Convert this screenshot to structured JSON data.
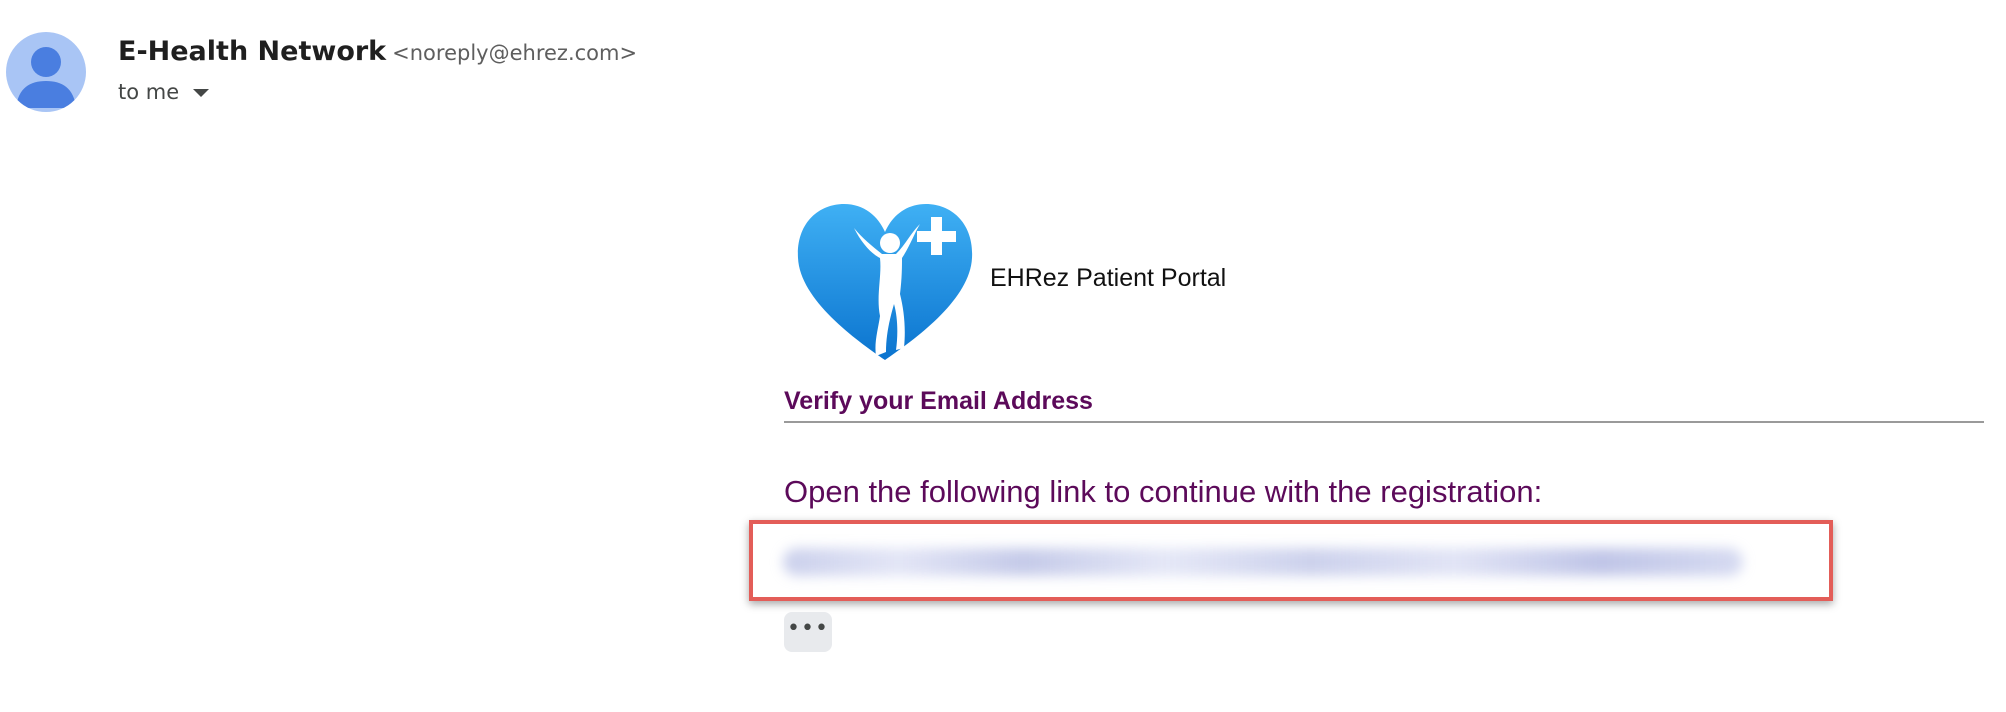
{
  "email": {
    "sender_name": "E-Health Network",
    "sender_email": "<noreply@ehrez.com>",
    "recipient": "to me"
  },
  "body": {
    "logo_icon": "heart-plus-person-icon",
    "portal_name": "EHRez Patient Portal",
    "title": "Verify your Email Address",
    "instruction": "Open the following link to continue with the registration:",
    "more_button": "•••"
  },
  "colors": {
    "title_purple": "#5c0a5a",
    "highlight_red": "#e35d58",
    "logo_blue": "#1f8ee0",
    "avatar_bg": "#a9c5f5",
    "avatar_fg": "#4a7ee0"
  }
}
